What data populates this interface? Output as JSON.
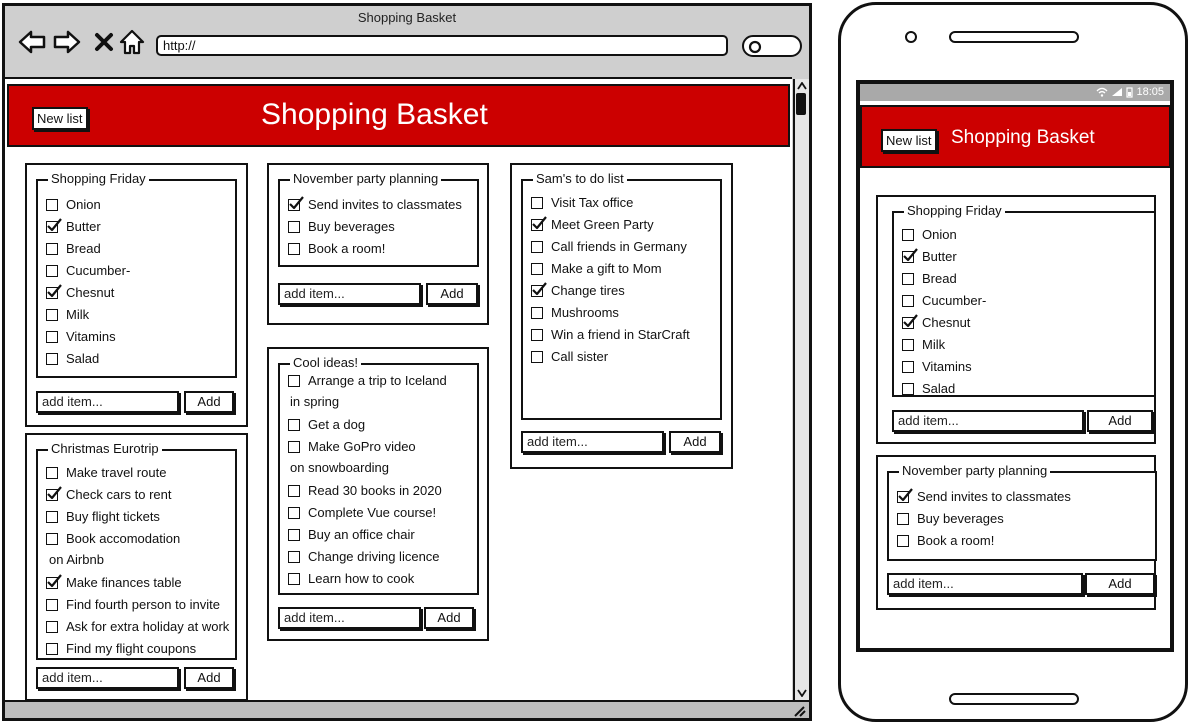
{
  "browser": {
    "window_title": "Shopping Basket",
    "url": "http://"
  },
  "app": {
    "title": "Shopping Basket",
    "new_list_label": "New list",
    "add_placeholder": "add item...",
    "add_label": "Add"
  },
  "lists": [
    {
      "title": "Shopping Friday",
      "items": [
        {
          "text": "Onion",
          "checked": false
        },
        {
          "text": "Butter",
          "checked": true
        },
        {
          "text": "Bread",
          "checked": false
        },
        {
          "text": "Cucumber-",
          "checked": false
        },
        {
          "text": "Chesnut",
          "checked": true
        },
        {
          "text": "Milk",
          "checked": false
        },
        {
          "text": "Vitamins",
          "checked": false
        },
        {
          "text": "Salad",
          "checked": false
        }
      ]
    },
    {
      "title": "Christmas Eurotrip",
      "items": [
        {
          "text": "Make travel route",
          "checked": false
        },
        {
          "text": "Check cars to rent",
          "checked": true
        },
        {
          "text": "Buy flight tickets",
          "checked": false
        },
        {
          "text": "Book accomodation",
          "cont": "on Airbnb",
          "checked": false
        },
        {
          "text": "Make finances table",
          "checked": true
        },
        {
          "text": "Find fourth person to invite",
          "checked": false
        },
        {
          "text": "Ask for extra holiday at work",
          "checked": false
        },
        {
          "text": "Find my flight coupons",
          "checked": false
        }
      ]
    },
    {
      "title": "November party planning",
      "items": [
        {
          "text": "Send invites to classmates",
          "checked": true
        },
        {
          "text": "Buy beverages",
          "checked": false
        },
        {
          "text": "Book a room!",
          "checked": false
        }
      ]
    },
    {
      "title": "Cool ideas!",
      "items": [
        {
          "text": "Arrange a trip to Iceland",
          "cont": "in spring",
          "checked": false
        },
        {
          "text": "Get a dog",
          "checked": false
        },
        {
          "text": "Make GoPro video",
          "cont": "on snowboarding",
          "checked": false
        },
        {
          "text": "Read 30 books in 2020",
          "checked": false
        },
        {
          "text": "Complete Vue course!",
          "checked": false
        },
        {
          "text": "Buy an office chair",
          "checked": false
        },
        {
          "text": "Change driving licence",
          "checked": false
        },
        {
          "text": "Learn how to cook",
          "checked": false
        }
      ]
    },
    {
      "title": "Sam's to do list",
      "items": [
        {
          "text": "Visit Tax office",
          "checked": false
        },
        {
          "text": "Meet Green Party",
          "checked": true
        },
        {
          "text": "Call friends in Germany",
          "checked": false
        },
        {
          "text": "Make a gift to Mom",
          "checked": false
        },
        {
          "text": "Change tires",
          "checked": true
        },
        {
          "text": "Mushrooms",
          "checked": false
        },
        {
          "text": "Win a friend in StarCraft",
          "checked": false
        },
        {
          "text": "Call sister",
          "checked": false
        }
      ]
    }
  ],
  "phone": {
    "time": "18:05"
  },
  "colors": {
    "header_red": "#cc0000",
    "frame": "#111111"
  }
}
